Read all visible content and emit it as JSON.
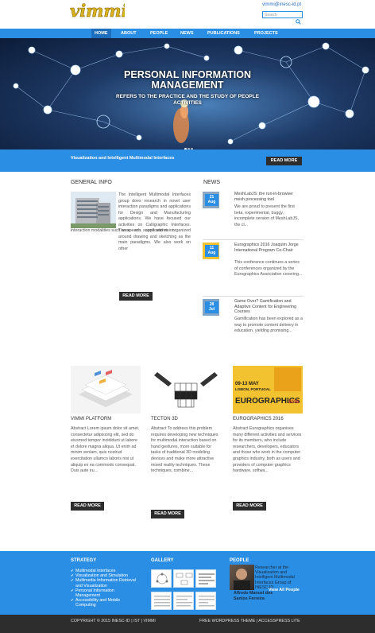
{
  "header": {
    "logo_text": "vimmi",
    "email": "vimmi@inesc-id.pt",
    "search_placeholder": "Search",
    "colors": {
      "accent": "#2b8ee5",
      "logo": "#d9b21f",
      "dark_button": "#2d2d2d"
    }
  },
  "nav": {
    "items": [
      "HOME",
      "ABOUT",
      "PEOPLE",
      "NEWS",
      "PUBLICATIONS",
      "PROJECTS"
    ],
    "active": "HOME"
  },
  "hero": {
    "title_line1": "PERSONAL INFORMATION",
    "title_line2": "MANAGEMENT",
    "subtitle_line1": "REFERS TO THE PRACTICE AND THE STUDY OF PEOPLE",
    "subtitle_line2": "ACTIVITIES"
  },
  "band": {
    "text": "Visualization and Intelligent Multimodal Interfaces",
    "button": "READ MORE"
  },
  "general_info": {
    "heading": "GENERAL INFO",
    "text_side": "The Intelligent Multimodal Interfaces group does research in novel user interaction paradigms and applications for Design and Manufacturing applications. We have focused our activities on Calligraphic Interfaces. These are applications organized around drawing and sketching as the main paradigms. We also work on other interaction modalities such as speech, sound and vision.",
    "button": "READ MORE"
  },
  "news": {
    "heading": "NEWS",
    "items": [
      {
        "day": "21",
        "month": "Aug",
        "title": "MeshLabJS: the run-in-browser mesh processing tool",
        "text": "We are proud to present the first beta, experimental, buggy, incomplete version of MeshLabJS, the cl..."
      },
      {
        "day": "11",
        "month": "Aug",
        "title": "Eurographics 2016 Joaquim Jorge International Program Co-Chair",
        "text": "This conference continues a series of conferences organized by the Eurographics Association covering..."
      },
      {
        "day": "28",
        "month": "Jul",
        "title": "Game Over? Gamification and Adaptive Content for Engineering Courses",
        "text": "Gamification has been explored as a way to promote content delivery in education, yielding promising..."
      }
    ]
  },
  "features": [
    {
      "title": "VIMMI PLATFORM",
      "text": "Abstract Lorem ipsum dolor sit amet, consectetur adipiscing elit, sed do eiusmod tempor incididunt ut labore et dolore magna aliqua. Ut enim ad minim veniam, quis nostrud exercitation ullamco laboris nisi ut aliquip ex ea commodo consequat. Duis aute iru...",
      "button": "READ MORE"
    },
    {
      "title": "TECTON 3D",
      "text": "Abstract To address this problem requires developing new techniques for multimodal interaction based on hand gestures, more suitable for tasks of traditional 3D modeling devices and make more attractive mixed reality techniques. These techniques, combine...",
      "button": "READ MORE"
    },
    {
      "title": "EUROGRAPHICS 2016",
      "text": "Abstract Eurographics organises many different activities and services for its members, who include researchers, developers, educators and those who work in the computer graphics industry, both as users and providers of computer graphics hardware, softwa...",
      "button": "READ MORE"
    }
  ],
  "eurographics_banner": {
    "dates": "09-13 MAY",
    "place": "LISBON, PORTUGAL",
    "name": "EUROGRAPHICS",
    "year": "2016"
  },
  "footer": {
    "strategy_heading": "STRATEGY",
    "strategy_items": [
      "Multimodal Interfaces",
      "Visualization and Simulation",
      "Multimedia Information Retrieval and Visualization",
      "Personal Information Management",
      "Accessibility and Mobile Computing"
    ],
    "gallery_heading": "GALLERY",
    "people_heading": "PEOPLE",
    "people_caption": "Researcher at the Visualization and Intelligent Multimodal Interfaces Group of INESC-ID",
    "people_name": "Alfredo Manuel dos Santos Ferreira",
    "view_all": "View All People"
  },
  "copyright": {
    "left": "COPYRIGHT © 2015 INESC-ID | IST | VIMMI",
    "right": "FREE WORDPRESS THEME | ACCESSPRESS LITE"
  }
}
